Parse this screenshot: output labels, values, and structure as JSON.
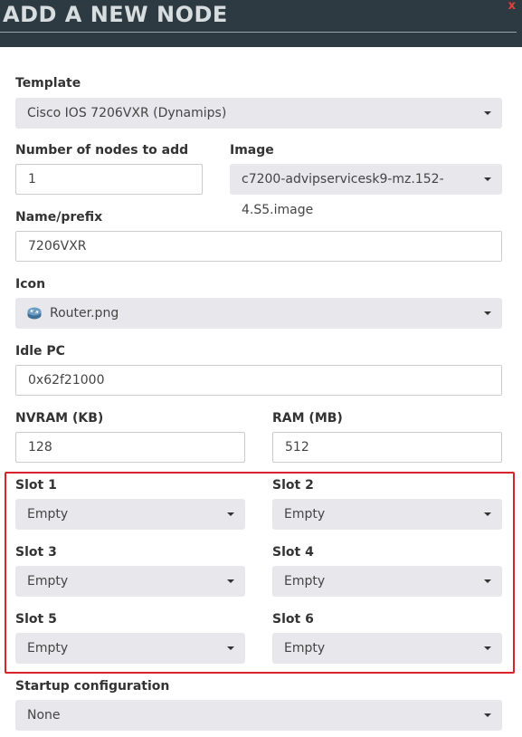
{
  "header": {
    "title": "ADD A NEW NODE",
    "close": "x"
  },
  "form": {
    "template": {
      "label": "Template",
      "value": "Cisco IOS 7206VXR (Dynamips)"
    },
    "count": {
      "label": "Number of nodes to add",
      "value": "1"
    },
    "image": {
      "label": "Image",
      "value": "c7200-advipservicesk9-mz.152-4.S5.image"
    },
    "name": {
      "label": "Name/prefix",
      "value": "7206VXR"
    },
    "icon": {
      "label": "Icon",
      "value": "Router.png",
      "icon_name": "router-icon"
    },
    "idlepc": {
      "label": "Idle PC",
      "value": "0x62f21000"
    },
    "nvram": {
      "label": "NVRAM (KB)",
      "value": "128"
    },
    "ram": {
      "label": "RAM (MB)",
      "value": "512"
    },
    "slots": [
      {
        "label": "Slot 1",
        "value": "Empty"
      },
      {
        "label": "Slot 2",
        "value": "Empty"
      },
      {
        "label": "Slot 3",
        "value": "Empty"
      },
      {
        "label": "Slot 4",
        "value": "Empty"
      },
      {
        "label": "Slot 5",
        "value": "Empty"
      },
      {
        "label": "Slot 6",
        "value": "Empty"
      }
    ],
    "startup": {
      "label": "Startup configuration",
      "value": "None"
    }
  },
  "colors": {
    "header_bg": "#2e3a42",
    "highlight_border": "#d9232d",
    "select_bg": "#e8e8ec"
  }
}
